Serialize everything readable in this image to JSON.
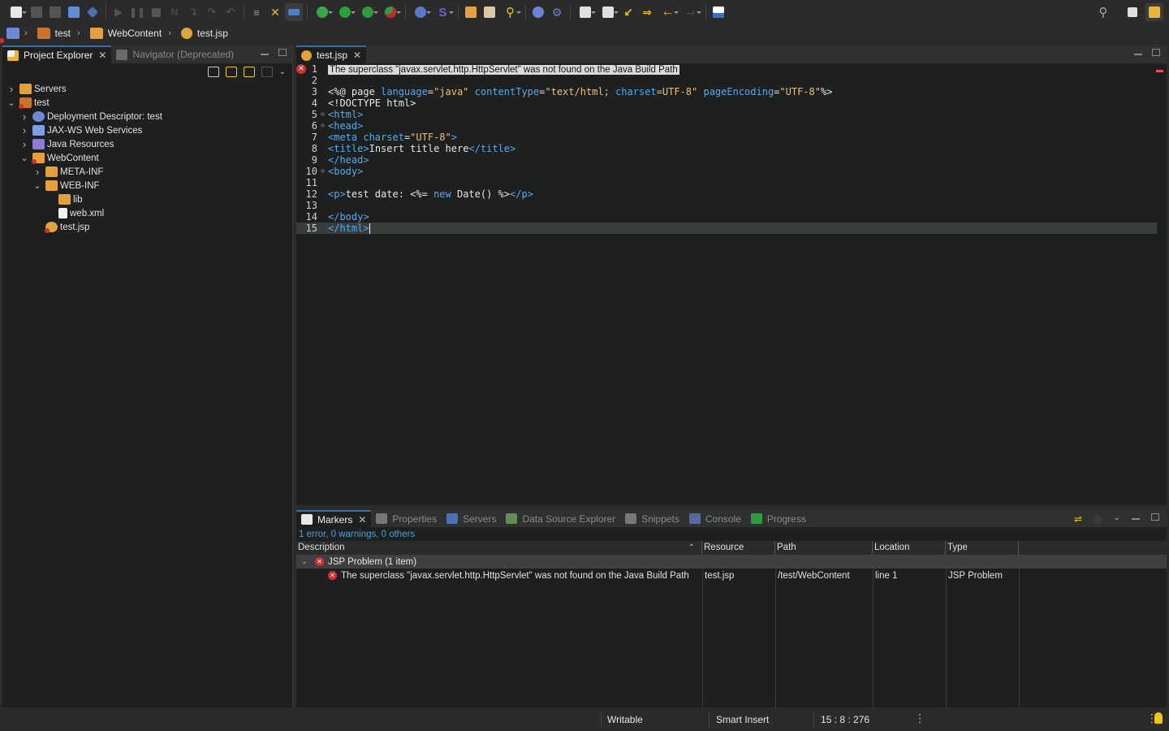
{
  "breadcrumb": {
    "items": [
      "test",
      "WebContent",
      "test.jsp"
    ]
  },
  "left_panel": {
    "tabs": [
      {
        "label": "Project Explorer",
        "active": true
      },
      {
        "label": "Navigator (Deprecated)",
        "active": false
      }
    ],
    "tree": [
      {
        "label": "Servers",
        "depth": 0,
        "expanded": false,
        "icon": "folder-icon"
      },
      {
        "label": "test",
        "depth": 0,
        "expanded": true,
        "icon": "web-project-icon"
      },
      {
        "label": "Deployment Descriptor: test",
        "depth": 1,
        "expanded": false,
        "icon": "deployment-descriptor-icon"
      },
      {
        "label": "JAX-WS Web Services",
        "depth": 1,
        "expanded": false,
        "icon": "web-services-icon"
      },
      {
        "label": "Java Resources",
        "depth": 1,
        "expanded": false,
        "icon": "java-resources-icon"
      },
      {
        "label": "WebContent",
        "depth": 1,
        "expanded": true,
        "icon": "folder-icon"
      },
      {
        "label": "META-INF",
        "depth": 2,
        "expanded": false,
        "icon": "folder-icon"
      },
      {
        "label": "WEB-INF",
        "depth": 2,
        "expanded": true,
        "icon": "folder-icon"
      },
      {
        "label": "lib",
        "depth": 3,
        "expanded": null,
        "icon": "folder-icon"
      },
      {
        "label": "web.xml",
        "depth": 3,
        "expanded": null,
        "icon": "xml-file-icon"
      },
      {
        "label": "test.jsp",
        "depth": 2,
        "expanded": null,
        "icon": "jsp-file-icon"
      }
    ]
  },
  "editor": {
    "tab_label": "test.jsp",
    "error_tooltip": "The superclass \"javax.servlet.http.HttpServlet\" was not found on the Java Build Path",
    "current_line": 15,
    "lines": [
      {
        "n": "1",
        "text": "",
        "error": true
      },
      {
        "n": "2",
        "text": ""
      },
      {
        "n": "3",
        "text": "<%@ page language=\"java\" contentType=\"text/html; charset=UTF-8\" pageEncoding=\"UTF-8\"%>"
      },
      {
        "n": "4",
        "text": "<!DOCTYPE html>"
      },
      {
        "n": "5",
        "text": "<html>",
        "fold": true
      },
      {
        "n": "6",
        "text": "<head>",
        "fold": true
      },
      {
        "n": "7",
        "text": "<meta charset=\"UTF-8\">"
      },
      {
        "n": "8",
        "text": "<title>Insert title here</title>"
      },
      {
        "n": "9",
        "text": "</head>"
      },
      {
        "n": "10",
        "text": "<body>",
        "fold": true
      },
      {
        "n": "11",
        "text": ""
      },
      {
        "n": "12",
        "text": "<p>test date: <%= new Date() %></p>"
      },
      {
        "n": "13",
        "text": ""
      },
      {
        "n": "14",
        "text": "</body>"
      },
      {
        "n": "15",
        "text": "</html>"
      }
    ]
  },
  "bottom_panel": {
    "tabs": [
      {
        "label": "Markers",
        "active": true
      },
      {
        "label": "Properties"
      },
      {
        "label": "Servers"
      },
      {
        "label": "Data Source Explorer"
      },
      {
        "label": "Snippets"
      },
      {
        "label": "Console"
      },
      {
        "label": "Progress"
      }
    ],
    "summary": "1 error, 0 warnings, 0 others",
    "columns": [
      "Description",
      "Resource",
      "Path",
      "Location",
      "Type"
    ],
    "group": "JSP Problem (1 item)",
    "rows": [
      {
        "description": "The superclass \"javax.servlet.http.HttpServlet\" was not found on the Java Build Path",
        "resource": "test.jsp",
        "path": "/test/WebContent",
        "location": "line 1",
        "type": "JSP Problem"
      }
    ]
  },
  "statusbar": {
    "writable": "Writable",
    "insert_mode": "Smart Insert",
    "position": "15 : 8 : 276"
  },
  "colors": {
    "accent": "#3a6ea5",
    "error": "#d32f2f",
    "link": "#4b9fd5",
    "tag": "#5aa9e6",
    "string": "#e5c07b",
    "folder": "#e59f3c"
  }
}
